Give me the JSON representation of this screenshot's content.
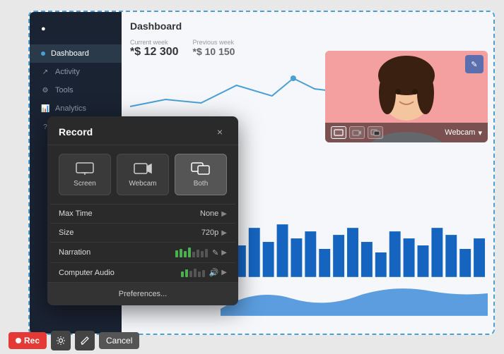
{
  "app": {
    "title": "Dashboard"
  },
  "sidebar": {
    "items": [
      {
        "label": "Dashboard",
        "active": true,
        "icon": "⊙"
      },
      {
        "label": "Activity",
        "active": false,
        "icon": "↗"
      },
      {
        "label": "Tools",
        "active": false,
        "icon": "⚙"
      },
      {
        "label": "Analytics",
        "active": false,
        "icon": "📊"
      },
      {
        "label": "Help",
        "active": false,
        "icon": "?"
      }
    ]
  },
  "stats": {
    "current_week_label": "Current week",
    "current_value": "*$ 12 300",
    "previous_week_label": "Previous week",
    "previous_value": "*$ 10 150"
  },
  "record_dialog": {
    "title": "Record",
    "close_label": "×",
    "modes": [
      {
        "label": "Screen",
        "active": false
      },
      {
        "label": "Webcam",
        "active": false
      },
      {
        "label": "Both",
        "active": true
      }
    ],
    "settings": [
      {
        "label": "Max Time",
        "value": "None",
        "has_arrow": true
      },
      {
        "label": "Size",
        "value": "720p",
        "has_arrow": true
      },
      {
        "label": "Narration",
        "value": "",
        "has_arrow": true,
        "has_volume": true,
        "has_pencil": true
      },
      {
        "label": "Computer Audio",
        "value": "",
        "has_arrow": true,
        "has_volume": true,
        "has_speaker": true
      }
    ],
    "preferences_label": "Preferences..."
  },
  "webcam": {
    "label": "Webcam",
    "edit_icon": "✎"
  },
  "bottom_toolbar": {
    "rec_label": "Rec",
    "cancel_label": "Cancel"
  }
}
